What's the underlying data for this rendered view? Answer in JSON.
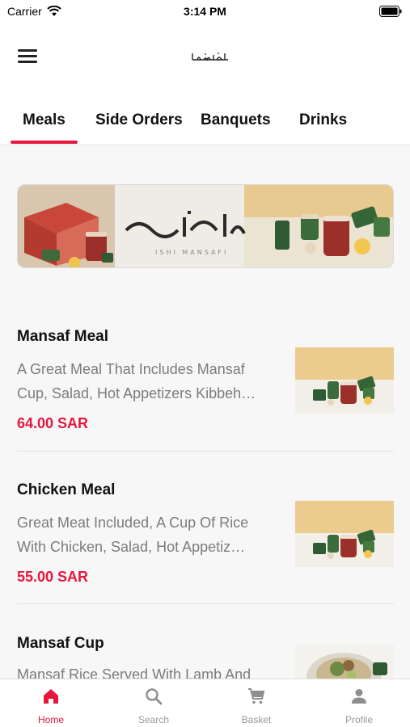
{
  "status_bar": {
    "carrier": "Carrier",
    "time": "3:14 PM"
  },
  "header": {
    "logo_icon": "brand-calligraphy-logo"
  },
  "tabs": [
    {
      "label": "Meals",
      "active": true
    },
    {
      "label": "Side Orders",
      "active": false
    },
    {
      "label": "Banquets",
      "active": false
    },
    {
      "label": "Drinks",
      "active": false
    }
  ],
  "banner": {
    "brand_text": "ISHI MANSAFI"
  },
  "meals": [
    {
      "name": "Mansaf Meal",
      "description_lines": [
        "A Great Meal That Includes Mansaf",
        "Cup, Salad, Hot Appetizers Kibbeh…"
      ],
      "price": "64.00 SAR"
    },
    {
      "name": "Chicken Meal",
      "description_lines": [
        "Great Meat Included, A Cup Of Rice",
        "With Chicken, Salad, Hot Appetiz…"
      ],
      "price": "55.00 SAR"
    },
    {
      "name": "Mansaf Cup",
      "description_lines": [
        "Mansaf Rice Served With Lamb And"
      ],
      "price": ""
    }
  ],
  "tab_bar": [
    {
      "label": "Home",
      "icon": "home-icon",
      "active": true
    },
    {
      "label": "Search",
      "icon": "search-icon",
      "active": false
    },
    {
      "label": "Basket",
      "icon": "cart-icon",
      "active": false
    },
    {
      "label": "Profile",
      "icon": "profile-icon",
      "active": false
    }
  ],
  "colors": {
    "accent": "#e5173e",
    "background": "#f7f7f7",
    "text_muted": "#7c7c7c"
  }
}
